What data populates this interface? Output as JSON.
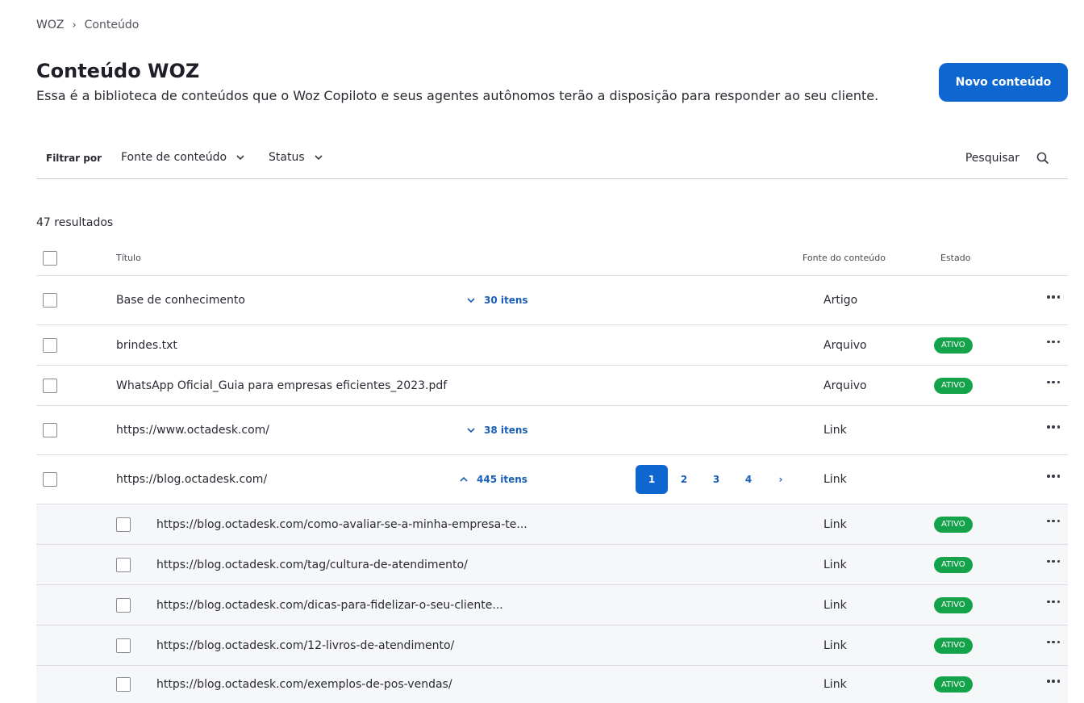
{
  "breadcrumb": {
    "root": "WOZ",
    "separator": "›",
    "current": "Conteúdo"
  },
  "header": {
    "title": "Conteúdo WOZ",
    "subtitle": "Essa é a biblioteca de conteúdos que o Woz Copiloto e seus agentes autônomos terão a disposição para responder ao seu cliente.",
    "new_button": "Novo conteúdo"
  },
  "filters": {
    "label": "Filtrar por",
    "source": "Fonte de conteúdo",
    "status": "Status",
    "search": "Pesquisar"
  },
  "results": "47 resultados",
  "table": {
    "col_title": "Título",
    "col_source": "Fonte do conteúdo",
    "col_state": "Estado",
    "rows": [
      {
        "title": "Base de conhecimento",
        "expand": "30 itens",
        "source": "Artigo",
        "state": ""
      },
      {
        "title": "brindes.txt",
        "source": "Arquivo",
        "state": "ATIVO"
      },
      {
        "title": "WhatsApp Oficial_Guia para empresas eficientes_2023.pdf",
        "source": "Arquivo",
        "state": "ATIVO"
      },
      {
        "title": "https://www.octadesk.com/",
        "expand": "38 itens",
        "source": "Link",
        "state": ""
      },
      {
        "title": "https://blog.octadesk.com/",
        "expand": "445 itens",
        "source": "Link",
        "state": ""
      }
    ],
    "children": [
      {
        "title": "https://blog.octadesk.com/como-avaliar-se-a-minha-empresa-te...",
        "source": "Link",
        "state": "ATIVO"
      },
      {
        "title": "https://blog.octadesk.com/tag/cultura-de-atendimento/",
        "source": "Link",
        "state": "ATIVO"
      },
      {
        "title": "https://blog.octadesk.com/dicas-para-fidelizar-o-seu-cliente...",
        "source": "Link",
        "state": "ATIVO"
      },
      {
        "title": "https://blog.octadesk.com/12-livros-de-atendimento/",
        "source": "Link",
        "state": "ATIVO"
      },
      {
        "title": "https://blog.octadesk.com/exemplos-de-pos-vendas/",
        "source": "Link",
        "state": "ATIVO"
      }
    ]
  },
  "pagination": {
    "pages": [
      "1",
      "2",
      "3",
      "4"
    ],
    "current": "1",
    "next": "›"
  },
  "colors": {
    "primary": "#0e66d0",
    "link": "#1a5fb4",
    "active_badge": "#14a34a"
  }
}
